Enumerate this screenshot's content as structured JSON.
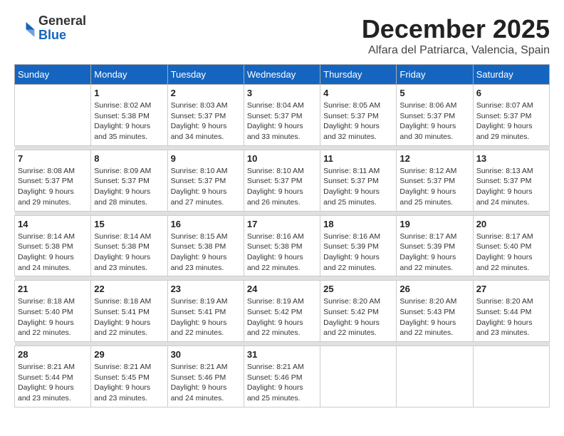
{
  "header": {
    "logo_general": "General",
    "logo_blue": "Blue",
    "month_year": "December 2025",
    "location": "Alfara del Patriarca, Valencia, Spain"
  },
  "days_of_week": [
    "Sunday",
    "Monday",
    "Tuesday",
    "Wednesday",
    "Thursday",
    "Friday",
    "Saturday"
  ],
  "weeks": [
    [
      {
        "day": "",
        "info": ""
      },
      {
        "day": "1",
        "info": "Sunrise: 8:02 AM\nSunset: 5:38 PM\nDaylight: 9 hours\nand 35 minutes."
      },
      {
        "day": "2",
        "info": "Sunrise: 8:03 AM\nSunset: 5:37 PM\nDaylight: 9 hours\nand 34 minutes."
      },
      {
        "day": "3",
        "info": "Sunrise: 8:04 AM\nSunset: 5:37 PM\nDaylight: 9 hours\nand 33 minutes."
      },
      {
        "day": "4",
        "info": "Sunrise: 8:05 AM\nSunset: 5:37 PM\nDaylight: 9 hours\nand 32 minutes."
      },
      {
        "day": "5",
        "info": "Sunrise: 8:06 AM\nSunset: 5:37 PM\nDaylight: 9 hours\nand 30 minutes."
      },
      {
        "day": "6",
        "info": "Sunrise: 8:07 AM\nSunset: 5:37 PM\nDaylight: 9 hours\nand 29 minutes."
      }
    ],
    [
      {
        "day": "7",
        "info": "Sunrise: 8:08 AM\nSunset: 5:37 PM\nDaylight: 9 hours\nand 29 minutes."
      },
      {
        "day": "8",
        "info": "Sunrise: 8:09 AM\nSunset: 5:37 PM\nDaylight: 9 hours\nand 28 minutes."
      },
      {
        "day": "9",
        "info": "Sunrise: 8:10 AM\nSunset: 5:37 PM\nDaylight: 9 hours\nand 27 minutes."
      },
      {
        "day": "10",
        "info": "Sunrise: 8:10 AM\nSunset: 5:37 PM\nDaylight: 9 hours\nand 26 minutes."
      },
      {
        "day": "11",
        "info": "Sunrise: 8:11 AM\nSunset: 5:37 PM\nDaylight: 9 hours\nand 25 minutes."
      },
      {
        "day": "12",
        "info": "Sunrise: 8:12 AM\nSunset: 5:37 PM\nDaylight: 9 hours\nand 25 minutes."
      },
      {
        "day": "13",
        "info": "Sunrise: 8:13 AM\nSunset: 5:37 PM\nDaylight: 9 hours\nand 24 minutes."
      }
    ],
    [
      {
        "day": "14",
        "info": "Sunrise: 8:14 AM\nSunset: 5:38 PM\nDaylight: 9 hours\nand 24 minutes."
      },
      {
        "day": "15",
        "info": "Sunrise: 8:14 AM\nSunset: 5:38 PM\nDaylight: 9 hours\nand 23 minutes."
      },
      {
        "day": "16",
        "info": "Sunrise: 8:15 AM\nSunset: 5:38 PM\nDaylight: 9 hours\nand 23 minutes."
      },
      {
        "day": "17",
        "info": "Sunrise: 8:16 AM\nSunset: 5:38 PM\nDaylight: 9 hours\nand 22 minutes."
      },
      {
        "day": "18",
        "info": "Sunrise: 8:16 AM\nSunset: 5:39 PM\nDaylight: 9 hours\nand 22 minutes."
      },
      {
        "day": "19",
        "info": "Sunrise: 8:17 AM\nSunset: 5:39 PM\nDaylight: 9 hours\nand 22 minutes."
      },
      {
        "day": "20",
        "info": "Sunrise: 8:17 AM\nSunset: 5:40 PM\nDaylight: 9 hours\nand 22 minutes."
      }
    ],
    [
      {
        "day": "21",
        "info": "Sunrise: 8:18 AM\nSunset: 5:40 PM\nDaylight: 9 hours\nand 22 minutes."
      },
      {
        "day": "22",
        "info": "Sunrise: 8:18 AM\nSunset: 5:41 PM\nDaylight: 9 hours\nand 22 minutes."
      },
      {
        "day": "23",
        "info": "Sunrise: 8:19 AM\nSunset: 5:41 PM\nDaylight: 9 hours\nand 22 minutes."
      },
      {
        "day": "24",
        "info": "Sunrise: 8:19 AM\nSunset: 5:42 PM\nDaylight: 9 hours\nand 22 minutes."
      },
      {
        "day": "25",
        "info": "Sunrise: 8:20 AM\nSunset: 5:42 PM\nDaylight: 9 hours\nand 22 minutes."
      },
      {
        "day": "26",
        "info": "Sunrise: 8:20 AM\nSunset: 5:43 PM\nDaylight: 9 hours\nand 22 minutes."
      },
      {
        "day": "27",
        "info": "Sunrise: 8:20 AM\nSunset: 5:44 PM\nDaylight: 9 hours\nand 23 minutes."
      }
    ],
    [
      {
        "day": "28",
        "info": "Sunrise: 8:21 AM\nSunset: 5:44 PM\nDaylight: 9 hours\nand 23 minutes."
      },
      {
        "day": "29",
        "info": "Sunrise: 8:21 AM\nSunset: 5:45 PM\nDaylight: 9 hours\nand 23 minutes."
      },
      {
        "day": "30",
        "info": "Sunrise: 8:21 AM\nSunset: 5:46 PM\nDaylight: 9 hours\nand 24 minutes."
      },
      {
        "day": "31",
        "info": "Sunrise: 8:21 AM\nSunset: 5:46 PM\nDaylight: 9 hours\nand 25 minutes."
      },
      {
        "day": "",
        "info": ""
      },
      {
        "day": "",
        "info": ""
      },
      {
        "day": "",
        "info": ""
      }
    ]
  ]
}
